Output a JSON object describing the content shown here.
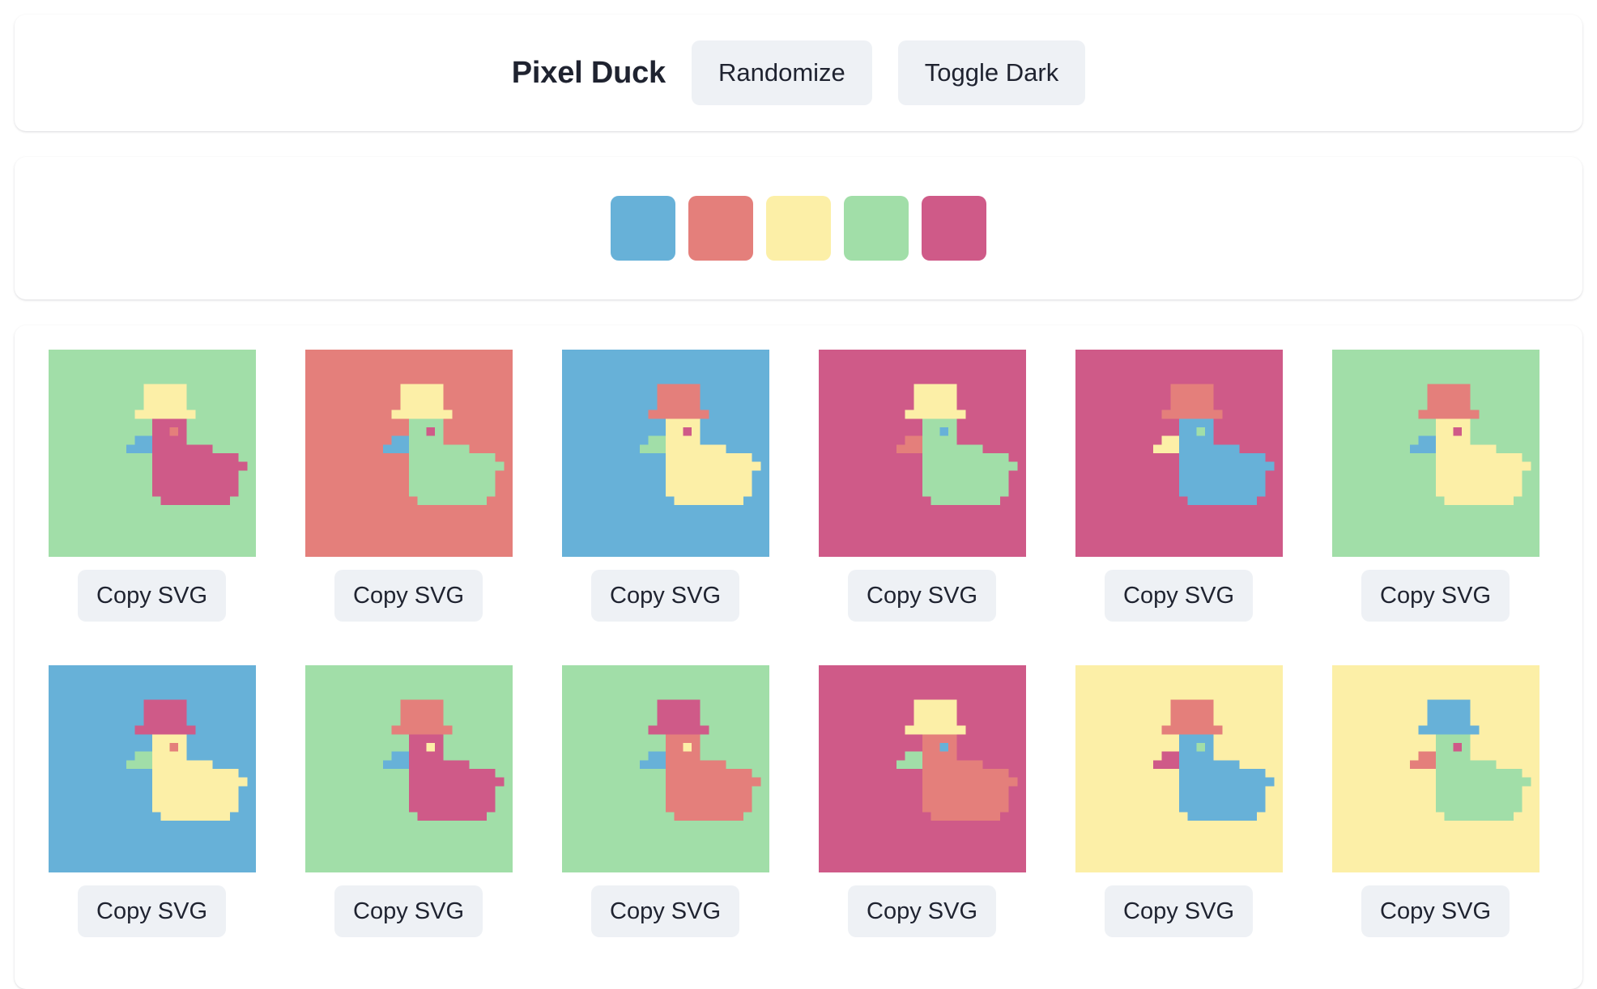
{
  "header": {
    "title": "Pixel Duck",
    "randomize_label": "Randomize",
    "toggle_dark_label": "Toggle Dark"
  },
  "palette": [
    {
      "name": "blue",
      "hex": "#67b1d8"
    },
    {
      "name": "coral",
      "hex": "#e47f7b"
    },
    {
      "name": "yellow",
      "hex": "#fcefa7"
    },
    {
      "name": "mint",
      "hex": "#a1dea8"
    },
    {
      "name": "magenta",
      "hex": "#cf5a88"
    }
  ],
  "copy_label": "Copy SVG",
  "ducks": [
    {
      "bg": "#a1dea8",
      "body": "#cf5a88",
      "hat": "#fcefa7",
      "beak": "#67b1d8",
      "eye": "#e47f7b"
    },
    {
      "bg": "#e47f7b",
      "body": "#a1dea8",
      "hat": "#fcefa7",
      "beak": "#67b1d8",
      "eye": "#cf5a88"
    },
    {
      "bg": "#67b1d8",
      "body": "#fcefa7",
      "hat": "#e47f7b",
      "beak": "#a1dea8",
      "eye": "#cf5a88"
    },
    {
      "bg": "#cf5a88",
      "body": "#a1dea8",
      "hat": "#fcefa7",
      "beak": "#e47f7b",
      "eye": "#67b1d8"
    },
    {
      "bg": "#cf5a88",
      "body": "#67b1d8",
      "hat": "#e47f7b",
      "beak": "#fcefa7",
      "eye": "#a1dea8"
    },
    {
      "bg": "#a1dea8",
      "body": "#fcefa7",
      "hat": "#e47f7b",
      "beak": "#67b1d8",
      "eye": "#cf5a88"
    },
    {
      "bg": "#67b1d8",
      "body": "#fcefa7",
      "hat": "#cf5a88",
      "beak": "#a1dea8",
      "eye": "#e47f7b"
    },
    {
      "bg": "#a1dea8",
      "body": "#cf5a88",
      "hat": "#e47f7b",
      "beak": "#67b1d8",
      "eye": "#fcefa7"
    },
    {
      "bg": "#a1dea8",
      "body": "#e47f7b",
      "hat": "#cf5a88",
      "beak": "#67b1d8",
      "eye": "#fcefa7"
    },
    {
      "bg": "#cf5a88",
      "body": "#e47f7b",
      "hat": "#fcefa7",
      "beak": "#a1dea8",
      "eye": "#67b1d8"
    },
    {
      "bg": "#fcefa7",
      "body": "#67b1d8",
      "hat": "#e47f7b",
      "beak": "#cf5a88",
      "eye": "#a1dea8"
    },
    {
      "bg": "#fcefa7",
      "body": "#a1dea8",
      "hat": "#67b1d8",
      "beak": "#e47f7b",
      "eye": "#cf5a88"
    }
  ]
}
